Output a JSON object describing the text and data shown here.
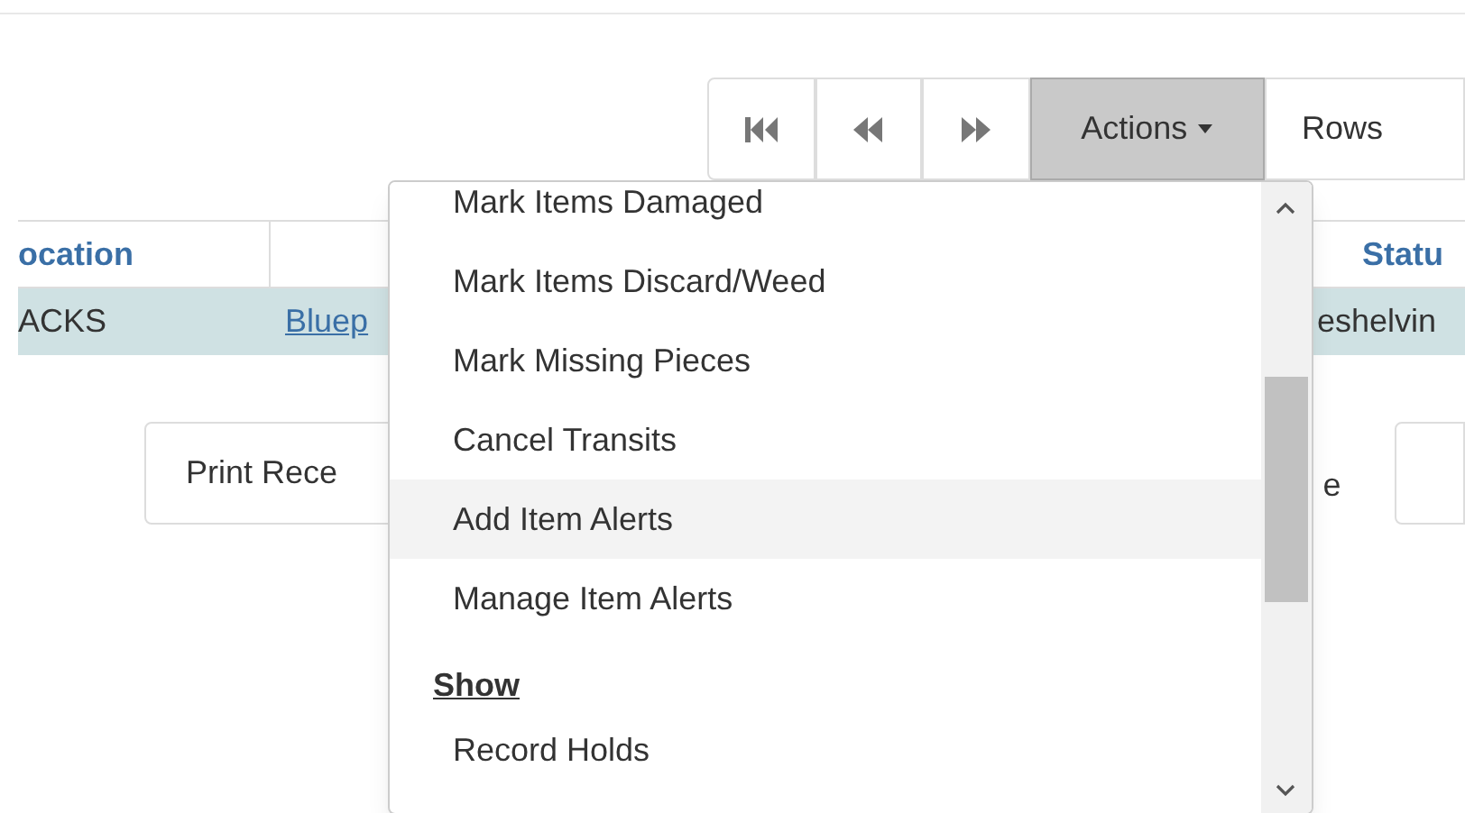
{
  "toolbar": {
    "actions": {
      "label": "Actions",
      "expanded": true
    },
    "rows_button": {
      "label": "Rows"
    }
  },
  "table": {
    "columns": {
      "location": "ocation",
      "status": "Statu"
    },
    "rows": [
      {
        "location": "ACKS",
        "title": "Bluep",
        "status": "eshelvin",
        "selected": true
      }
    ]
  },
  "footer": {
    "print_button": "Print Rece",
    "side_text": "e"
  },
  "actions_menu": {
    "items": [
      {
        "kind": "item",
        "label": "Mark Items Damaged",
        "selected": false
      },
      {
        "kind": "item",
        "label": "Mark Items Discard/Weed",
        "selected": false
      },
      {
        "kind": "item",
        "label": "Mark Missing Pieces",
        "selected": false
      },
      {
        "kind": "item",
        "label": "Cancel Transits",
        "selected": false
      },
      {
        "kind": "item",
        "label": "Add Item Alerts",
        "selected": true
      },
      {
        "kind": "item",
        "label": "Manage Item Alerts",
        "selected": false
      },
      {
        "kind": "heading",
        "label": "Show"
      },
      {
        "kind": "item",
        "label": "Record Holds",
        "selected": false
      }
    ]
  }
}
